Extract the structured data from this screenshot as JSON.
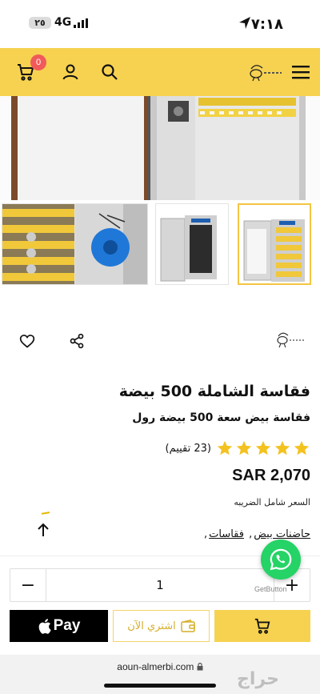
{
  "status_bar": {
    "time": "٧:١٨",
    "network": "4G",
    "battery": "٢٥"
  },
  "header": {
    "cart_count": "0",
    "brand_color": "#f6d250"
  },
  "product": {
    "title": "فقاسة الشاملة 500 بيضة",
    "subtitle": "فقاسة بيض سعة 500 بيضة رول",
    "rating_stars": 5,
    "rating_count": "(23 تقييم)",
    "price": "SAR 2,070",
    "tax_note": "السعر شامل الضريبه",
    "categories": [
      "حاضنات بيض",
      "فقاسات"
    ],
    "category_separator": ","
  },
  "quantity": {
    "value": "1",
    "minus": "−",
    "plus": "+"
  },
  "buttons": {
    "apple_pay": "Pay",
    "buy_now": "اشتري الآن"
  },
  "whatsapp": {
    "label": "GetButton"
  },
  "browser": {
    "url": "aoun-almerbi.com"
  },
  "watermark": "حراج"
}
